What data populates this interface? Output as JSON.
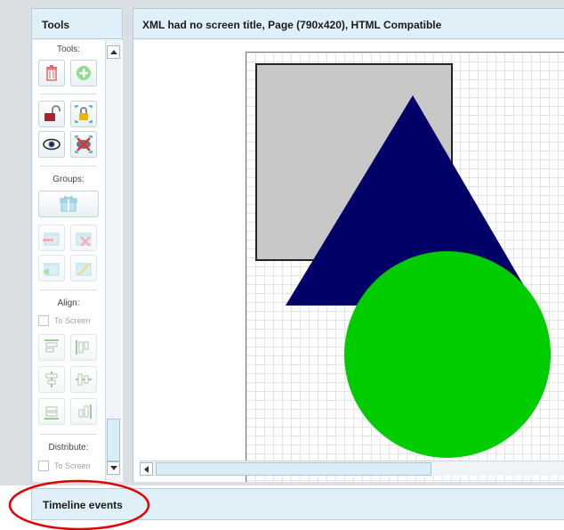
{
  "tools_panel": {
    "title": "Tools",
    "sections": {
      "tools_label": "Tools:",
      "groups_label": "Groups:",
      "align_label": "Align:",
      "align_to_screen": "To Screen",
      "distribute_label": "Distribute:",
      "distribute_to_screen": "To Screen"
    },
    "buttons": [
      {
        "icon": "trash-icon"
      },
      {
        "icon": "add-circle-icon"
      },
      {
        "icon": "unlock-icon"
      },
      {
        "icon": "lock-icon"
      },
      {
        "icon": "eye-icon"
      },
      {
        "icon": "hide-icon"
      },
      {
        "icon": "group-icon"
      },
      {
        "icon": "ungroup-icon"
      },
      {
        "icon": "remove-from-group-icon"
      },
      {
        "icon": "add-to-group-icon"
      },
      {
        "icon": "edit-group-icon"
      },
      {
        "icon": "align-top-icon"
      },
      {
        "icon": "align-left-icon"
      },
      {
        "icon": "align-center-horizontal-icon"
      },
      {
        "icon": "align-center-vertical-icon"
      },
      {
        "icon": "align-bottom-icon"
      },
      {
        "icon": "align-right-icon"
      }
    ]
  },
  "canvas_panel": {
    "title": "XML had no screen title, Page (790x420), HTML Compatible",
    "shapes": [
      {
        "type": "rectangle",
        "fill": "#c8c8c8",
        "stroke": "#222222"
      },
      {
        "type": "triangle",
        "fill": "#000066"
      },
      {
        "type": "circle",
        "fill": "#00cc00"
      }
    ]
  },
  "timeline": {
    "title": "Timeline events"
  },
  "colors": {
    "panel_header": "#dff0f8",
    "panel_border": "#b9cdd6",
    "annotation_ring": "#e00000"
  }
}
